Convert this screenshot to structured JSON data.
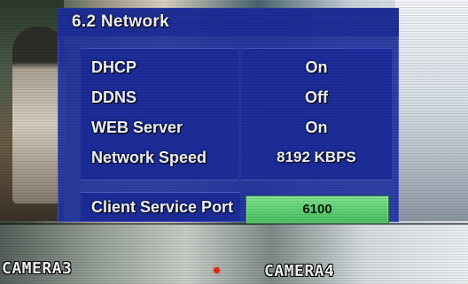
{
  "menu": {
    "title": "6.2 Network",
    "rows": [
      {
        "label": "DHCP",
        "value": "On"
      },
      {
        "label": "DDNS",
        "value": "Off"
      },
      {
        "label": "WEB Server",
        "value": "On"
      },
      {
        "label": "Network Speed",
        "value": "8192 KBPS"
      }
    ],
    "client_service_port": {
      "label": "Client Service Port",
      "value": "6100"
    }
  },
  "cameras": {
    "left_label": "CAMERA3",
    "right_label": "CAMERA4"
  },
  "colors": {
    "menu_background": "#2134A0",
    "selected_field": "#62D276",
    "text": "#F4F8FF",
    "record_indicator": "#E0261E"
  },
  "icons": {
    "record_indicator": "record-dot-icon"
  }
}
